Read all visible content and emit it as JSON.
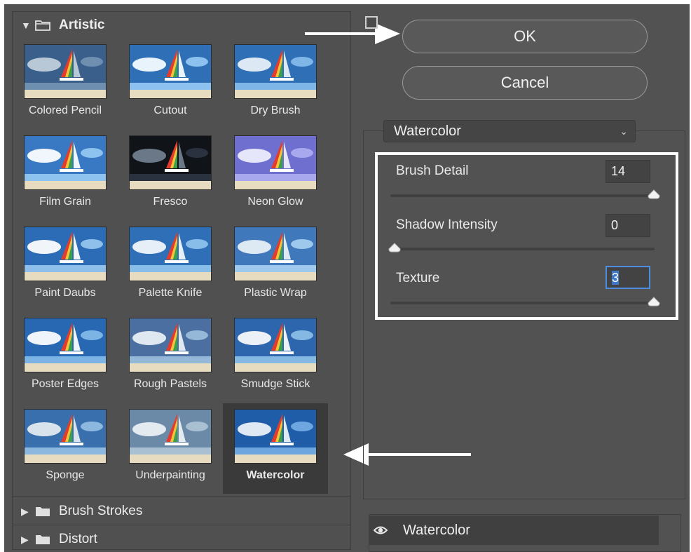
{
  "gallery": {
    "categories": [
      {
        "label": "Artistic",
        "expanded": true
      },
      {
        "label": "Brush Strokes",
        "expanded": false
      },
      {
        "label": "Distort",
        "expanded": false
      }
    ],
    "filters": [
      {
        "label": "Colored Pencil"
      },
      {
        "label": "Cutout"
      },
      {
        "label": "Dry Brush"
      },
      {
        "label": "Film Grain"
      },
      {
        "label": "Fresco"
      },
      {
        "label": "Neon Glow"
      },
      {
        "label": "Paint Daubs"
      },
      {
        "label": "Palette Knife"
      },
      {
        "label": "Plastic Wrap"
      },
      {
        "label": "Poster Edges"
      },
      {
        "label": "Rough Pastels"
      },
      {
        "label": "Smudge Stick"
      },
      {
        "label": "Sponge"
      },
      {
        "label": "Underpainting"
      },
      {
        "label": "Watercolor"
      }
    ],
    "selected": "Watercolor"
  },
  "buttons": {
    "ok": "OK",
    "cancel": "Cancel"
  },
  "filter_select": {
    "value": "Watercolor"
  },
  "params": [
    {
      "label": "Brush Detail",
      "value": "14",
      "fraction": 1.0
    },
    {
      "label": "Shadow Intensity",
      "value": "0",
      "fraction": 0.0
    },
    {
      "label": "Texture",
      "value": "3",
      "fraction": 1.0
    }
  ],
  "effect_layers": [
    {
      "label": "Watercolor",
      "visible": true
    }
  ],
  "colors": {
    "highlight": "#ffffff",
    "panel": "#525252",
    "field_focus": "#4d8ee0"
  }
}
